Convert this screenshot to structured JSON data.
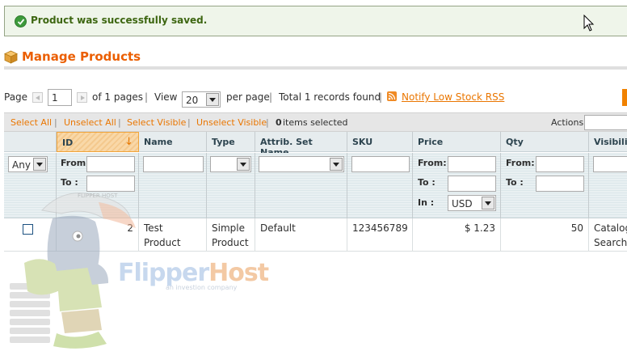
{
  "message": {
    "text": "Product was successfully saved."
  },
  "header": {
    "title": "Manage Products"
  },
  "pager": {
    "page_label": "Page",
    "page_value": "1",
    "of_pages": "of 1 pages",
    "sep1": "|",
    "view_label": "View",
    "per_page_value": "20",
    "per_page_label": "per page",
    "sep2": "|",
    "total": "Total 1 records found",
    "sep3": "|",
    "rss_link": "Notify Low Stock RSS"
  },
  "massaction": {
    "select_all": "Select All",
    "unselect_all": "Unselect All",
    "select_visible": "Select Visible",
    "unselect_visible": "Unselect Visible",
    "pipe": "|",
    "selected_count": "0",
    "selected_label": "items selected",
    "actions_label": "Actions"
  },
  "columns": [
    "ID",
    "Name",
    "Type",
    "Attrib. Set Name",
    "SKU",
    "Price",
    "Qty",
    "Visibilit"
  ],
  "filters": {
    "massaction_value": "Any",
    "from": "From:",
    "to": "To :",
    "in": "In :",
    "currency": "USD"
  },
  "rows": [
    {
      "id": "2",
      "name": "Test Product",
      "type_line1": "Simple",
      "type_line2": "Product",
      "attrib_set": "Default",
      "sku": "123456789",
      "price": "$ 1.23",
      "qty": "50",
      "visibility_line1": "Catalog",
      "visibility_line2": "Search"
    }
  ],
  "watermark": {
    "brand_a": "Flipper",
    "brand_b": "Host",
    "tagline": "an investion company",
    "cap_text": "FLIPPER HOST"
  },
  "colors": {
    "accent": "#eb5e00",
    "link": "#ea7601",
    "success": "#3d6611"
  }
}
